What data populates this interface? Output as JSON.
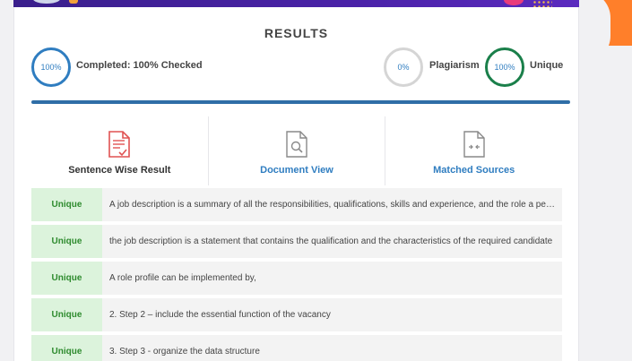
{
  "results": {
    "title": "RESULTS",
    "completed": {
      "percent": "100%",
      "label": "Completed: 100% Checked"
    },
    "plagiarism": {
      "percent": "0%",
      "label": "Plagiarism"
    },
    "unique": {
      "percent": "100%",
      "label": "Unique"
    }
  },
  "tabs": [
    {
      "label": "Sentence Wise Result",
      "icon": "sentence-report-icon",
      "active": true
    },
    {
      "label": "Document View",
      "icon": "document-search-icon",
      "active": false
    },
    {
      "label": "Matched Sources",
      "icon": "document-compare-icon",
      "active": false
    }
  ],
  "rows": [
    {
      "status": "Unique",
      "text": "A job description is a summary of all the responsibilities, qualifications, skills and experience, and the role a person has to play in an organization"
    },
    {
      "status": "Unique",
      "text": "the job description is a statement that contains the qualification and the characteristics of the required candidate"
    },
    {
      "status": "Unique",
      "text": "A role profile can be implemented by,"
    },
    {
      "status": "Unique",
      "text": "2. Step 2 – include the essential function of the vacancy"
    },
    {
      "status": "Unique",
      "text": "3. Step 3 - organize the data structure"
    }
  ],
  "colors": {
    "accent_blue": "#2f7dc0",
    "unique_green": "#1a7f4a",
    "badge_bg": "#dcf3dc",
    "banner_purple": "#3a1f8c",
    "side_orange": "#ff7f2a"
  }
}
